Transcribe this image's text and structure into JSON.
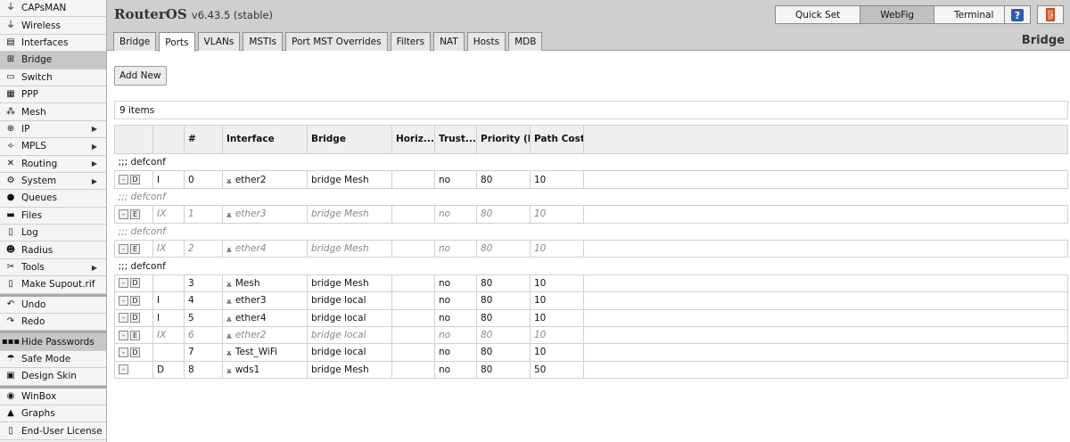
{
  "sidebar": {
    "groups": [
      [
        {
          "label": "CAPsMAN",
          "icon": "capsman-icon",
          "glyph": "⏚"
        },
        {
          "label": "Wireless",
          "icon": "wireless-icon",
          "glyph": "⏚"
        },
        {
          "label": "Interfaces",
          "icon": "interfaces-icon",
          "glyph": "▤"
        },
        {
          "label": "Bridge",
          "icon": "bridge-icon",
          "glyph": "⊞",
          "active": true
        },
        {
          "label": "Switch",
          "icon": "switch-icon",
          "glyph": "▭"
        },
        {
          "label": "PPP",
          "icon": "ppp-icon",
          "glyph": "▦"
        },
        {
          "label": "Mesh",
          "icon": "mesh-icon",
          "glyph": "⁂"
        },
        {
          "label": "IP",
          "icon": "ip-icon",
          "glyph": "⊕",
          "submenu": true
        },
        {
          "label": "MPLS",
          "icon": "mpls-icon",
          "glyph": "⟡",
          "submenu": true
        },
        {
          "label": "Routing",
          "icon": "routing-icon",
          "glyph": "✕",
          "submenu": true
        },
        {
          "label": "System",
          "icon": "system-icon",
          "glyph": "⚙",
          "submenu": true
        },
        {
          "label": "Queues",
          "icon": "queues-icon",
          "glyph": "●"
        },
        {
          "label": "Files",
          "icon": "files-icon",
          "glyph": "▬"
        },
        {
          "label": "Log",
          "icon": "log-icon",
          "glyph": "▯"
        },
        {
          "label": "Radius",
          "icon": "radius-icon",
          "glyph": "☻"
        },
        {
          "label": "Tools",
          "icon": "tools-icon",
          "glyph": "✂",
          "submenu": true
        },
        {
          "label": "Make Supout.rif",
          "icon": "supout-icon",
          "glyph": "▯"
        }
      ],
      [
        {
          "label": "Undo",
          "icon": "undo-icon",
          "glyph": "↶"
        },
        {
          "label": "Redo",
          "icon": "redo-icon",
          "glyph": "↷"
        }
      ],
      [
        {
          "label": "Hide Passwords",
          "icon": "hide-passwords-icon",
          "glyph": "▪▪▪",
          "active": true
        },
        {
          "label": "Safe Mode",
          "icon": "safe-mode-icon",
          "glyph": "☂"
        },
        {
          "label": "Design Skin",
          "icon": "design-skin-icon",
          "glyph": "▣"
        }
      ],
      [
        {
          "label": "WinBox",
          "icon": "winbox-icon",
          "glyph": "◉"
        },
        {
          "label": "Graphs",
          "icon": "graphs-icon",
          "glyph": "▲"
        },
        {
          "label": "End-User License",
          "icon": "license-icon",
          "glyph": "▯"
        }
      ]
    ]
  },
  "header": {
    "title": "RouterOS",
    "version": "v6.43.5 (stable)",
    "modes": [
      {
        "label": "Quick Set",
        "selected": false
      },
      {
        "label": "WebFig",
        "selected": true
      },
      {
        "label": "Terminal",
        "selected": false
      }
    ],
    "section_title": "Bridge"
  },
  "tabs": [
    {
      "label": "Bridge",
      "active": false
    },
    {
      "label": "Ports",
      "active": true
    },
    {
      "label": "VLANs",
      "active": false
    },
    {
      "label": "MSTIs",
      "active": false
    },
    {
      "label": "Port MST Overrides",
      "active": false
    },
    {
      "label": "Filters",
      "active": false
    },
    {
      "label": "NAT",
      "active": false
    },
    {
      "label": "Hosts",
      "active": false
    },
    {
      "label": "MDB",
      "active": false
    }
  ],
  "toolbar": {
    "add_new_label": "Add New"
  },
  "list": {
    "count_label": "9 items",
    "columns": [
      "",
      "",
      "#",
      "Interface",
      "Bridge",
      "Horiz...",
      "Trust...",
      "Priority (hex)",
      "Path Cost",
      ""
    ],
    "rows": [
      {
        "comment": ";;; defconf",
        "disabled": false
      },
      {
        "buttons": [
          "-",
          "D"
        ],
        "flags": "I",
        "num": "0",
        "interface": "ether2",
        "bridge": "bridge Mesh",
        "horizon": "",
        "trusted": "no",
        "priority": "80",
        "path_cost": "10",
        "disabled": false
      },
      {
        "comment": ";;; defconf",
        "disabled": true
      },
      {
        "buttons": [
          "-",
          "E"
        ],
        "flags": "IX",
        "num": "1",
        "interface": "ether3",
        "bridge": "bridge Mesh",
        "horizon": "",
        "trusted": "no",
        "priority": "80",
        "path_cost": "10",
        "disabled": true
      },
      {
        "comment": ";;; defconf",
        "disabled": true
      },
      {
        "buttons": [
          "-",
          "E"
        ],
        "flags": "IX",
        "num": "2",
        "interface": "ether4",
        "bridge": "bridge Mesh",
        "horizon": "",
        "trusted": "no",
        "priority": "80",
        "path_cost": "10",
        "disabled": true
      },
      {
        "comment": ";;; defconf",
        "disabled": false
      },
      {
        "buttons": [
          "-",
          "D"
        ],
        "flags": "",
        "num": "3",
        "interface": "Mesh",
        "bridge": "bridge Mesh",
        "horizon": "",
        "trusted": "no",
        "priority": "80",
        "path_cost": "10",
        "disabled": false
      },
      {
        "buttons": [
          "-",
          "D"
        ],
        "flags": "I",
        "num": "4",
        "interface": "ether3",
        "bridge": "bridge local",
        "horizon": "",
        "trusted": "no",
        "priority": "80",
        "path_cost": "10",
        "disabled": false
      },
      {
        "buttons": [
          "-",
          "D"
        ],
        "flags": "I",
        "num": "5",
        "interface": "ether4",
        "bridge": "bridge local",
        "horizon": "",
        "trusted": "no",
        "priority": "80",
        "path_cost": "10",
        "disabled": false
      },
      {
        "buttons": [
          "-",
          "E"
        ],
        "flags": "IX",
        "num": "6",
        "interface": "ether2",
        "bridge": "bridge local",
        "horizon": "",
        "trusted": "no",
        "priority": "80",
        "path_cost": "10",
        "disabled": true
      },
      {
        "buttons": [
          "-",
          "D"
        ],
        "flags": "",
        "num": "7",
        "interface": "Test_WiFi",
        "bridge": "bridge local",
        "horizon": "",
        "trusted": "no",
        "priority": "80",
        "path_cost": "10",
        "disabled": false
      },
      {
        "buttons": [
          "-"
        ],
        "flags": "D",
        "num": "8",
        "interface": "wds1",
        "bridge": "bridge Mesh",
        "horizon": "",
        "trusted": "no",
        "priority": "80",
        "path_cost": "50",
        "disabled": false
      }
    ]
  },
  "colors": {
    "header_bg": "#cfcfcf",
    "sidebar_active": "#c7c7c7",
    "disabled_text": "#888888"
  }
}
